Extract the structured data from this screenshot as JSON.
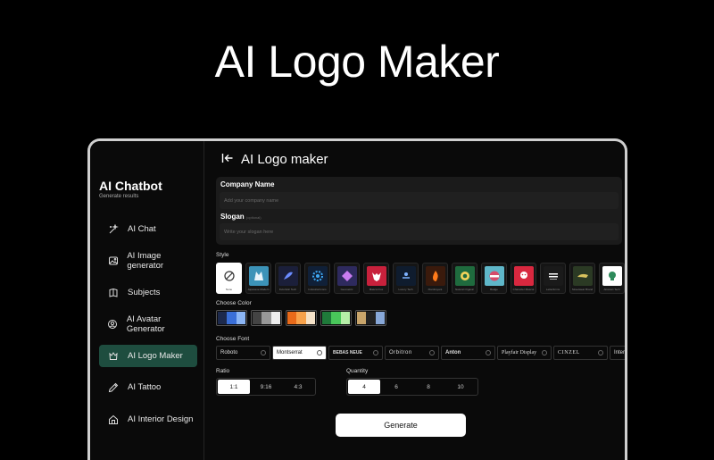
{
  "hero_title": "AI Logo Maker",
  "colors": {
    "accent": "#1e4d3f",
    "close": "#ff5f57",
    "minimize": "#febc2e",
    "maximize": "#28c840"
  },
  "sidebar": {
    "brand": "AI Chatbot",
    "subtitle": "Generate results",
    "items": [
      {
        "label": "AI Chat",
        "icon": "sparkle-icon"
      },
      {
        "label": "AI Image generator",
        "icon": "image-icon"
      },
      {
        "label": "Subjects",
        "icon": "book-icon"
      },
      {
        "label": "AI Avatar Generator",
        "icon": "avatar-icon"
      },
      {
        "label": "AI Logo Maker",
        "icon": "logo-icon",
        "active": true
      },
      {
        "label": "AI Tattoo",
        "icon": "pen-icon"
      },
      {
        "label": "AI Interior Design",
        "icon": "house-icon"
      }
    ]
  },
  "main": {
    "title": "AI Logo maker",
    "company_label": "Company Name",
    "company_placeholder": "Add your company name",
    "slogan_label": "Slogan",
    "slogan_hint": "(optional)",
    "slogan_placeholder": "Write your slogan here",
    "style_label": "Style",
    "styles": [
      {
        "caption": "None"
      },
      {
        "caption": "Japanese Modern"
      },
      {
        "caption": "Futuristic Tech"
      },
      {
        "caption": "Industrial Icons"
      },
      {
        "caption": "Geometric"
      },
      {
        "caption": "Mascot Fox"
      },
      {
        "caption": "Luxury Tech"
      },
      {
        "caption": "Flamboyant"
      },
      {
        "caption": "Natural Organic"
      },
      {
        "caption": "Badge"
      },
      {
        "caption": "Character Mascot"
      },
      {
        "caption": "Letterforms"
      },
      {
        "caption": "Streetwear Brand"
      },
      {
        "caption": "Abstract Tech"
      }
    ],
    "color_label": "Choose Color",
    "palettes": [
      [
        "#1d2a4d",
        "#3a6fd8",
        "#8cb6f5"
      ],
      [
        "#444444",
        "#999999",
        "#eeeeee"
      ],
      [
        "#e86a1a",
        "#f7a24b",
        "#f5e2c8"
      ],
      [
        "#1f7a3a",
        "#49c75a",
        "#b6f0a8"
      ],
      [
        "#c9a56b",
        "#222222",
        "#88a8d8"
      ]
    ],
    "font_label": "Choose Font",
    "fonts": [
      "Roboto",
      "Montserrat",
      "BEBAS NEUE",
      "Orbitron",
      "Anton",
      "Playfair Display",
      "CINZEL",
      "Inter"
    ],
    "ratio_label": "Ratio",
    "ratios": [
      "1:1",
      "9:16",
      "4:3"
    ],
    "quantity_label": "Quantity",
    "quantities": [
      "4",
      "6",
      "8",
      "10"
    ],
    "generate_label": "Generate"
  }
}
